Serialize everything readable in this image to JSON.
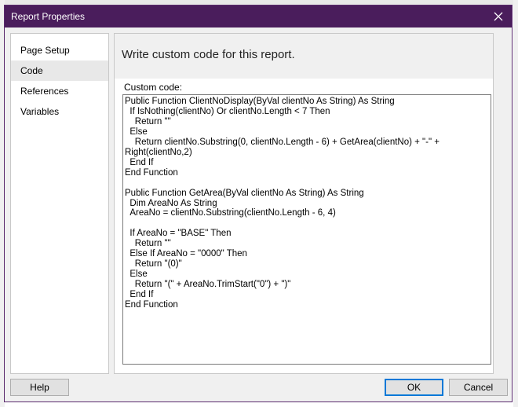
{
  "window": {
    "title": "Report Properties"
  },
  "nav": {
    "items": [
      {
        "label": "Page Setup",
        "selected": false
      },
      {
        "label": "Code",
        "selected": true
      },
      {
        "label": "References",
        "selected": false
      },
      {
        "label": "Variables",
        "selected": false
      }
    ]
  },
  "content": {
    "heading": "Write custom code for this report.",
    "code_label": "Custom code:",
    "code": "Public Function ClientNoDisplay(ByVal clientNo As String) As String\n  If IsNothing(clientNo) Or clientNo.Length < 7 Then\n    Return \"\"\n  Else\n    Return clientNo.Substring(0, clientNo.Length - 6) + GetArea(clientNo) + \"-\" + Right(clientNo,2)\n  End If\nEnd Function\n\nPublic Function GetArea(ByVal clientNo As String) As String\n  Dim AreaNo As String\n  AreaNo = clientNo.Substring(clientNo.Length - 6, 4)\n\n  If AreaNo = \"BASE\" Then\n    Return \"\"\n  Else If AreaNo = \"0000\" Then\n    Return \"(0)\"\n  Else\n    Return \"(\" + AreaNo.TrimStart(\"0\") + \")\"\n  End If\nEnd Function"
  },
  "buttons": {
    "help": "Help",
    "ok": "OK",
    "cancel": "Cancel"
  },
  "colors": {
    "titlebar": "#4a1d5c",
    "accent": "#0078d7"
  },
  "icons": {
    "close": "close-icon"
  }
}
